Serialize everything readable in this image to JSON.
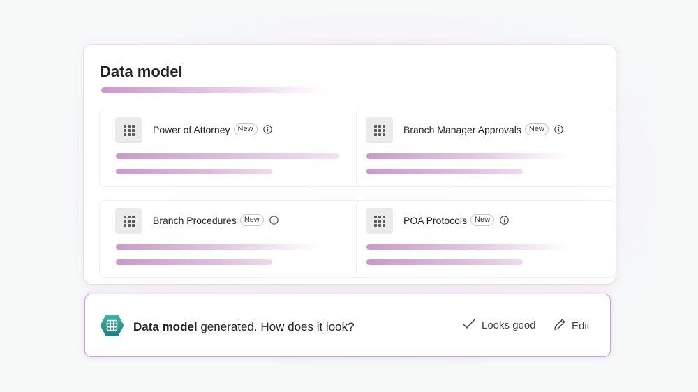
{
  "card": {
    "title": "Data model",
    "tables": [
      {
        "name": "Power of Attorney",
        "badge": "New"
      },
      {
        "name": "Branch Manager Approvals",
        "badge": "New"
      },
      {
        "name": "Branch Procedures",
        "badge": "New"
      },
      {
        "name": "POA Protocols",
        "badge": "New"
      }
    ]
  },
  "prompt": {
    "bold": "Data model",
    "rest": " generated. How does it look?",
    "looks_good_label": "Looks good",
    "edit_label": "Edit"
  },
  "icons": {
    "table": "table-grid-icon",
    "info": "info-icon",
    "app": "hexagon-table-icon",
    "check": "checkmark-icon",
    "edit": "pencil-icon"
  },
  "colors": {
    "accent_border": "#c6a2e6",
    "skeleton_bar": "#c99ac9",
    "app_icon_top": "#3fb6a0",
    "app_icon_bottom": "#1d7f8a"
  }
}
